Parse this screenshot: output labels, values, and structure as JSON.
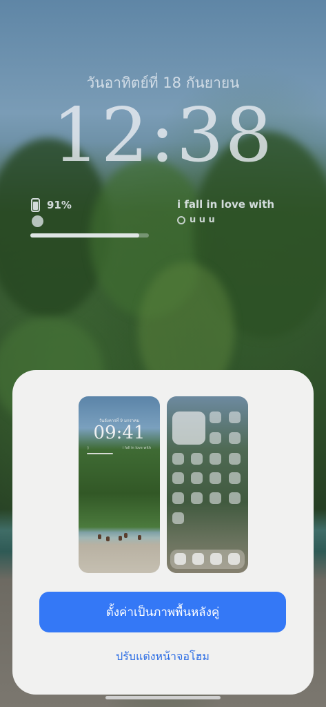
{
  "lock_screen": {
    "date": "วันอาทิตย์ที่ 18 กันยายน",
    "time": "12:38",
    "battery_percent": "91%",
    "battery_level": 0.91,
    "music_title": "i fall in love with",
    "music_artist": "u u u",
    "progress_fraction": 0.92
  },
  "preview_lock": {
    "date": "วันอังคารที่ 9 มกราคม",
    "time": "09:41",
    "music_title": "i fall in love with",
    "battery_text": "▯"
  },
  "actions": {
    "set_wallpaper_pair": "ตั้งค่าเป็นภาพพื้นหลังคู่",
    "customize_home": "ปรับแต่งหน้าจอโฮม"
  },
  "colors": {
    "accent": "#3478f6",
    "link": "#2f6fe4",
    "sheet": "#f1f1f0"
  }
}
